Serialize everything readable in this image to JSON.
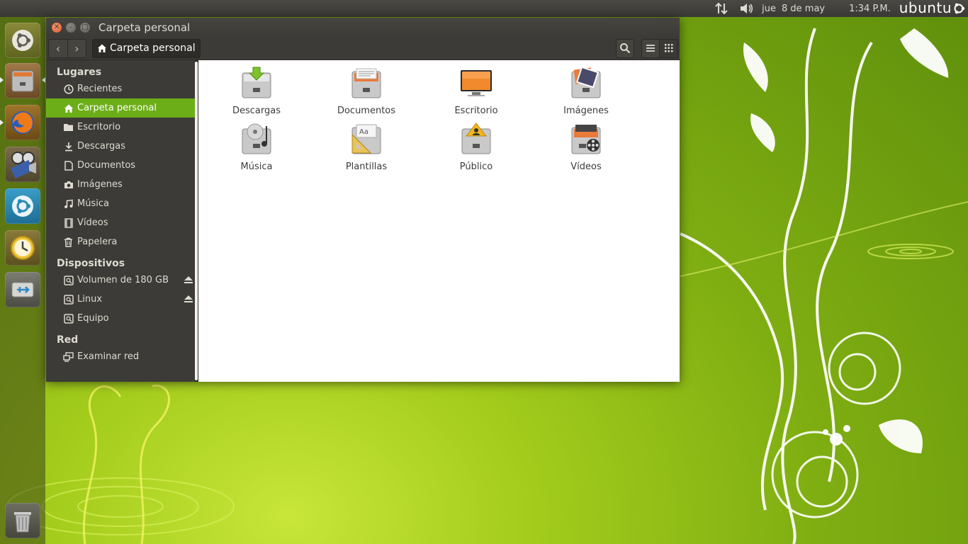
{
  "panel": {
    "date_day": "jue",
    "date_rest": "8 de may",
    "time": "1:34 P.M.",
    "brand": "ubuntu",
    "icons": [
      "network-transfer-icon",
      "volume-icon",
      "ubuntu-session-icon"
    ]
  },
  "launcher": {
    "items": [
      {
        "name": "dash-home",
        "icon": "ubuntu-logo-icon"
      },
      {
        "name": "files",
        "icon": "file-cabinet-icon",
        "active": true
      },
      {
        "name": "firefox",
        "icon": "firefox-icon"
      },
      {
        "name": "video-editor",
        "icon": "film-clapper-icon"
      },
      {
        "name": "software-center",
        "icon": "ubuntu-software-icon"
      },
      {
        "name": "backup",
        "icon": "clock-backup-icon"
      },
      {
        "name": "usb-drive",
        "icon": "usb-drive-icon"
      },
      {
        "name": "trash",
        "icon": "trash-icon"
      }
    ]
  },
  "window": {
    "title": "Carpeta personal",
    "path_label": "Carpeta personal"
  },
  "sidebar": {
    "places_header": "Lugares",
    "places": [
      {
        "label": "Recientes",
        "icon": "clock-icon"
      },
      {
        "label": "Carpeta personal",
        "icon": "home-icon",
        "selected": true
      },
      {
        "label": "Escritorio",
        "icon": "folder-icon"
      },
      {
        "label": "Descargas",
        "icon": "download-icon"
      },
      {
        "label": "Documentos",
        "icon": "document-icon"
      },
      {
        "label": "Imágenes",
        "icon": "camera-icon"
      },
      {
        "label": "Música",
        "icon": "music-icon"
      },
      {
        "label": "Vídeos",
        "icon": "film-icon"
      },
      {
        "label": "Papelera",
        "icon": "trash-icon"
      }
    ],
    "devices_header": "Dispositivos",
    "devices": [
      {
        "label": "Volumen de 180 GB",
        "icon": "drive-icon",
        "eject": true
      },
      {
        "label": "Linux",
        "icon": "drive-icon",
        "eject": true
      },
      {
        "label": "Equipo",
        "icon": "drive-icon",
        "eject": false
      }
    ],
    "network_header": "Red",
    "network": [
      {
        "label": "Examinar red",
        "icon": "network-icon"
      }
    ]
  },
  "files": [
    {
      "label": "Descargas",
      "icon": "folder-downloads-icon"
    },
    {
      "label": "Documentos",
      "icon": "folder-documents-icon"
    },
    {
      "label": "Escritorio",
      "icon": "folder-desktop-icon"
    },
    {
      "label": "Imágenes",
      "icon": "folder-pictures-icon"
    },
    {
      "label": "Música",
      "icon": "folder-music-icon"
    },
    {
      "label": "Plantillas",
      "icon": "folder-templates-icon"
    },
    {
      "label": "Público",
      "icon": "folder-public-icon"
    },
    {
      "label": "Vídeos",
      "icon": "folder-videos-icon"
    }
  ],
  "colors": {
    "accent": "#6cae18",
    "panel": "#3c3b37",
    "wallpaper": "#8fbf16"
  }
}
